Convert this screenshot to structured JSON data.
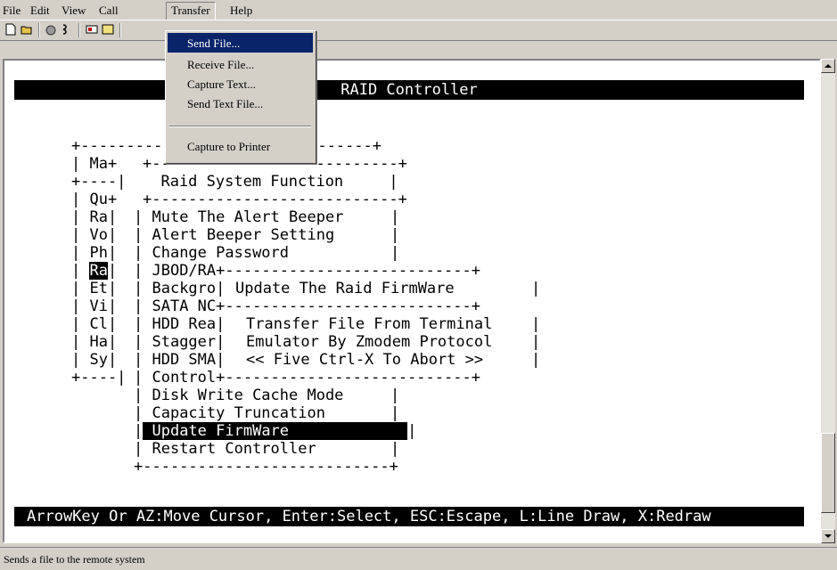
{
  "menubar": {
    "items": [
      {
        "label": "File",
        "key": "F"
      },
      {
        "label": "Edit",
        "key": "E"
      },
      {
        "label": "View",
        "key": "V"
      },
      {
        "label": "Call",
        "key": "C"
      },
      {
        "label": "Transfer",
        "key": "T"
      },
      {
        "label": "Help",
        "key": "H"
      }
    ]
  },
  "toolbar": {
    "icons": [
      "new-icon",
      "open-icon",
      "connect-icon",
      "disconnect-icon",
      "send-icon",
      "receive-icon"
    ]
  },
  "transfer_menu": {
    "items": [
      {
        "label": "Send File...",
        "selected": true
      },
      {
        "label": "Receive File..."
      },
      {
        "label": "Capture Text..."
      },
      {
        "label": "Send Text File..."
      },
      {
        "label": "Capture to Printer"
      }
    ]
  },
  "terminal": {
    "title": "RAID Controller",
    "main_menu": {
      "top_border": "+--------------------------------+",
      "rows": [
        "| Ma+",
        "+----|",
        "| Qu+",
        "| Ra|",
        "| Vo|",
        "| Ph|",
        "| Ra|",
        "| Et|",
        "| Vi|",
        "| Cl|",
        "| Ha|",
        "| Sy|",
        "+----|"
      ]
    },
    "raid_function": {
      "top": "+---------------------------+",
      "title": "Raid System Function",
      "title_line": "  Raid System Function     |",
      "sep": "+---------------------------+",
      "items": [
        "Mute The Alert Beeper",
        "Alert Beeper Setting",
        "Change Password",
        "JBOD/RA",
        "Backgro",
        "SATA NC",
        "HDD Rea",
        "Stagger",
        "HDD SMA",
        "Control",
        "Disk Write Cache Mode",
        "Capacity Truncation",
        "Update FirmWare",
        "Restart Controller"
      ],
      "bottom": "+---------------------------+"
    },
    "firmware_box": {
      "title": "Update The Raid FirmWare",
      "lines": [
        "Transfer File From Terminal",
        "Emulator By Zmodem Protocol",
        "<< Five Ctrl-X To Abort >>"
      ]
    },
    "help": "ArrowKey Or AZ:Move Cursor, Enter:Select, ESC:Escape, L:Line Draw, X:Redraw"
  },
  "status": {
    "text": "Sends a file to the remote system"
  }
}
